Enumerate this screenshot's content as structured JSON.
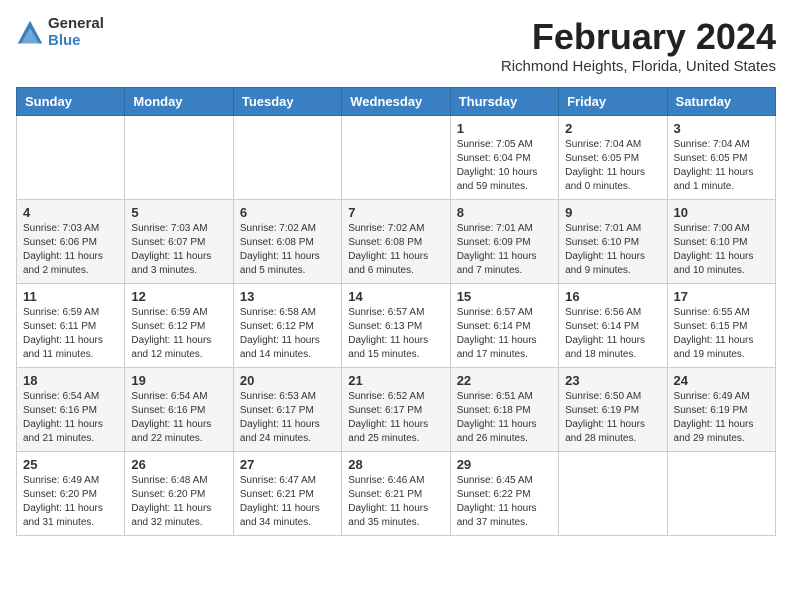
{
  "logo": {
    "general": "General",
    "blue": "Blue"
  },
  "title": "February 2024",
  "subtitle": "Richmond Heights, Florida, United States",
  "days_of_week": [
    "Sunday",
    "Monday",
    "Tuesday",
    "Wednesday",
    "Thursday",
    "Friday",
    "Saturday"
  ],
  "weeks": [
    [
      {
        "day": "",
        "info": ""
      },
      {
        "day": "",
        "info": ""
      },
      {
        "day": "",
        "info": ""
      },
      {
        "day": "",
        "info": ""
      },
      {
        "day": "1",
        "info": "Sunrise: 7:05 AM\nSunset: 6:04 PM\nDaylight: 10 hours\nand 59 minutes."
      },
      {
        "day": "2",
        "info": "Sunrise: 7:04 AM\nSunset: 6:05 PM\nDaylight: 11 hours\nand 0 minutes."
      },
      {
        "day": "3",
        "info": "Sunrise: 7:04 AM\nSunset: 6:05 PM\nDaylight: 11 hours\nand 1 minute."
      }
    ],
    [
      {
        "day": "4",
        "info": "Sunrise: 7:03 AM\nSunset: 6:06 PM\nDaylight: 11 hours\nand 2 minutes."
      },
      {
        "day": "5",
        "info": "Sunrise: 7:03 AM\nSunset: 6:07 PM\nDaylight: 11 hours\nand 3 minutes."
      },
      {
        "day": "6",
        "info": "Sunrise: 7:02 AM\nSunset: 6:08 PM\nDaylight: 11 hours\nand 5 minutes."
      },
      {
        "day": "7",
        "info": "Sunrise: 7:02 AM\nSunset: 6:08 PM\nDaylight: 11 hours\nand 6 minutes."
      },
      {
        "day": "8",
        "info": "Sunrise: 7:01 AM\nSunset: 6:09 PM\nDaylight: 11 hours\nand 7 minutes."
      },
      {
        "day": "9",
        "info": "Sunrise: 7:01 AM\nSunset: 6:10 PM\nDaylight: 11 hours\nand 9 minutes."
      },
      {
        "day": "10",
        "info": "Sunrise: 7:00 AM\nSunset: 6:10 PM\nDaylight: 11 hours\nand 10 minutes."
      }
    ],
    [
      {
        "day": "11",
        "info": "Sunrise: 6:59 AM\nSunset: 6:11 PM\nDaylight: 11 hours\nand 11 minutes."
      },
      {
        "day": "12",
        "info": "Sunrise: 6:59 AM\nSunset: 6:12 PM\nDaylight: 11 hours\nand 12 minutes."
      },
      {
        "day": "13",
        "info": "Sunrise: 6:58 AM\nSunset: 6:12 PM\nDaylight: 11 hours\nand 14 minutes."
      },
      {
        "day": "14",
        "info": "Sunrise: 6:57 AM\nSunset: 6:13 PM\nDaylight: 11 hours\nand 15 minutes."
      },
      {
        "day": "15",
        "info": "Sunrise: 6:57 AM\nSunset: 6:14 PM\nDaylight: 11 hours\nand 17 minutes."
      },
      {
        "day": "16",
        "info": "Sunrise: 6:56 AM\nSunset: 6:14 PM\nDaylight: 11 hours\nand 18 minutes."
      },
      {
        "day": "17",
        "info": "Sunrise: 6:55 AM\nSunset: 6:15 PM\nDaylight: 11 hours\nand 19 minutes."
      }
    ],
    [
      {
        "day": "18",
        "info": "Sunrise: 6:54 AM\nSunset: 6:16 PM\nDaylight: 11 hours\nand 21 minutes."
      },
      {
        "day": "19",
        "info": "Sunrise: 6:54 AM\nSunset: 6:16 PM\nDaylight: 11 hours\nand 22 minutes."
      },
      {
        "day": "20",
        "info": "Sunrise: 6:53 AM\nSunset: 6:17 PM\nDaylight: 11 hours\nand 24 minutes."
      },
      {
        "day": "21",
        "info": "Sunrise: 6:52 AM\nSunset: 6:17 PM\nDaylight: 11 hours\nand 25 minutes."
      },
      {
        "day": "22",
        "info": "Sunrise: 6:51 AM\nSunset: 6:18 PM\nDaylight: 11 hours\nand 26 minutes."
      },
      {
        "day": "23",
        "info": "Sunrise: 6:50 AM\nSunset: 6:19 PM\nDaylight: 11 hours\nand 28 minutes."
      },
      {
        "day": "24",
        "info": "Sunrise: 6:49 AM\nSunset: 6:19 PM\nDaylight: 11 hours\nand 29 minutes."
      }
    ],
    [
      {
        "day": "25",
        "info": "Sunrise: 6:49 AM\nSunset: 6:20 PM\nDaylight: 11 hours\nand 31 minutes."
      },
      {
        "day": "26",
        "info": "Sunrise: 6:48 AM\nSunset: 6:20 PM\nDaylight: 11 hours\nand 32 minutes."
      },
      {
        "day": "27",
        "info": "Sunrise: 6:47 AM\nSunset: 6:21 PM\nDaylight: 11 hours\nand 34 minutes."
      },
      {
        "day": "28",
        "info": "Sunrise: 6:46 AM\nSunset: 6:21 PM\nDaylight: 11 hours\nand 35 minutes."
      },
      {
        "day": "29",
        "info": "Sunrise: 6:45 AM\nSunset: 6:22 PM\nDaylight: 11 hours\nand 37 minutes."
      },
      {
        "day": "",
        "info": ""
      },
      {
        "day": "",
        "info": ""
      }
    ]
  ]
}
